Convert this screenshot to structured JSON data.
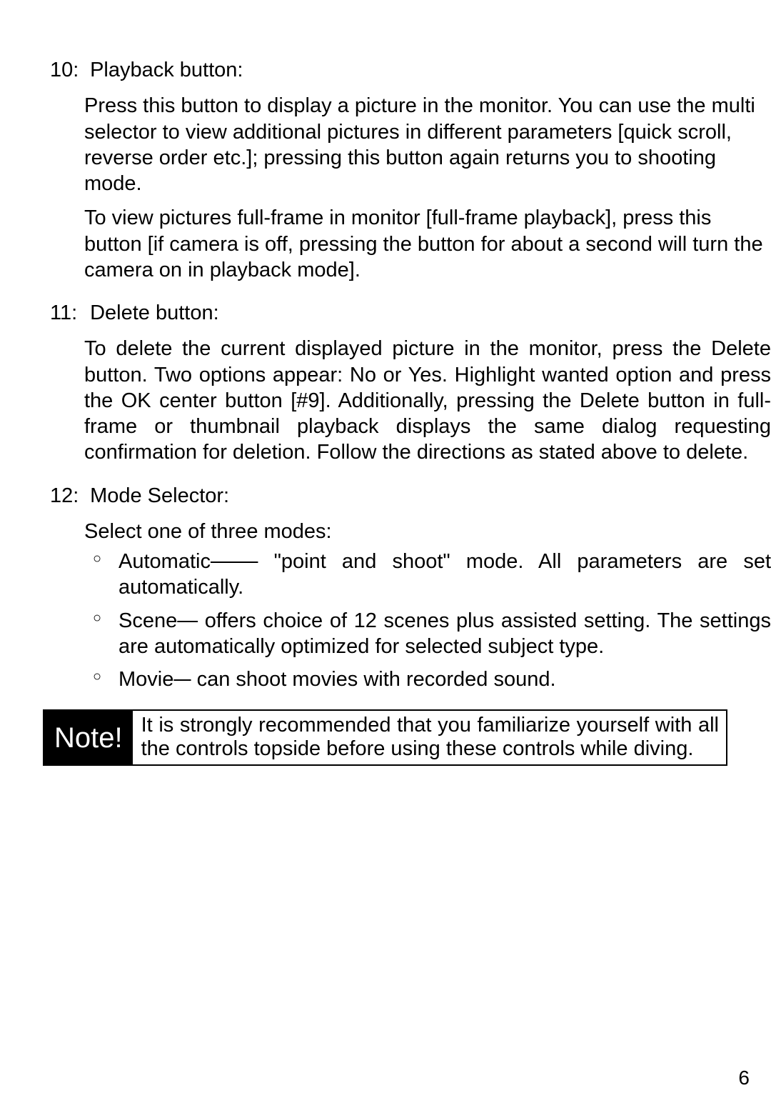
{
  "page_number": "6",
  "sections": [
    {
      "num": "10:",
      "title": "Playback button:",
      "paragraphs": [
        "Press this button to display a picture in the monitor. You can use the multi selector to view additional pictures in different parameters [quick scroll, reverse order etc.]; pressing this button again returns you to shooting mode.",
        "To view pictures full-frame in monitor [full-frame playback], press this button [if camera is off, pressing the button for about a second will turn the camera on in playback mode]."
      ]
    },
    {
      "num": "11:",
      "title": "Delete button:",
      "paragraphs": [
        "To delete the current displayed picture in the monitor, press the Delete button. Two options appear: No or Yes. Highlight wanted option and press the OK center button [#9]. Additionally, pressing the Delete button in full-frame or thumbnail playback displays the same dialog requesting confirmation for deletion. Follow the directions as stated above to delete."
      ]
    },
    {
      "num": "12:",
      "title": "Mode Selector:",
      "intro": "Select one of three modes:",
      "modes": [
        {
          "name": "Automatic",
          "desc": "  \"point and shoot\" mode. All parameters are set automatically."
        },
        {
          "name": "Scene",
          "desc": "  offers choice of 12 scenes plus assisted setting. The settings are automatically optimized for selected subject type."
        },
        {
          "name": "Movie",
          "desc": "  can shoot movies with recorded sound."
        }
      ]
    }
  ],
  "note": {
    "label": "Note!",
    "text": "It is strongly recommended that you familiarize yourself with all the controls topside before using these controls while diving."
  }
}
